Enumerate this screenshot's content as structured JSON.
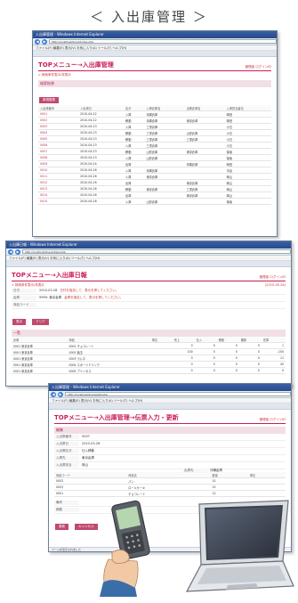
{
  "heading": "＜ 入出庫管理 ＞",
  "win1": {
    "titlebar": "入出庫管理 - Windows Internet Explorer",
    "address": "http://localhost/Inout/index.php",
    "menubar": "ファイル(F)  編集(E)  表示(V)  お気に入り(A)  ツール(T)  ヘルプ(H)",
    "page_title": "TOPメニュー→入出庫管理",
    "page_right": "管理者 ログインID",
    "link": "> 検索条件表示/非表示",
    "section": "検索結果",
    "new_btn": "新規登録",
    "headers": [
      "入出庫番号",
      "入出庫日",
      "区分",
      "入庫倉庫名",
      "出庫倉庫名",
      "入庫担当者名"
    ],
    "rows": [
      [
        "0001",
        "2010-04-22",
        "入庫",
        "沖縄倉庫",
        "",
        "岡田"
      ],
      [
        "0002",
        "2010-04-22",
        "移動",
        "沖縄倉庫",
        "東京倉庫",
        "岡田"
      ],
      [
        "0003",
        "2010-04-23",
        "入庫",
        "三重倉庫",
        "",
        "小島"
      ],
      [
        "0004",
        "2010-04-23",
        "移動",
        "三重倉庫",
        "山形倉庫",
        "小島"
      ],
      [
        "0005",
        "2010-04-23",
        "移動",
        "三重倉庫",
        "三重倉庫",
        "小島"
      ],
      [
        "0006",
        "2010-04-23",
        "入庫",
        "三重倉庫",
        "",
        "小島"
      ],
      [
        "0007",
        "2010-04-23",
        "移動",
        "山形倉庫",
        "東京倉庫",
        "保坂"
      ],
      [
        "0008",
        "2010-04-23",
        "入庫",
        "山形倉庫",
        "",
        "保坂"
      ],
      [
        "0009",
        "2010-04-24",
        "出庫",
        "",
        "沖縄倉庫",
        "岡田"
      ],
      [
        "0010",
        "2010-04-26",
        "入庫",
        "沖縄倉庫",
        "",
        "中谷"
      ],
      [
        "0011",
        "2010-04-26",
        "入庫",
        "東京倉庫",
        "",
        "岡山"
      ],
      [
        "0012",
        "2010-04-26",
        "出庫",
        "",
        "東京倉庫",
        "岡山"
      ],
      [
        "0013",
        "2010-04-26",
        "移動",
        "東京倉庫",
        "三重倉庫",
        "岡山"
      ],
      [
        "0014",
        "2010-04-26",
        "出庫",
        "",
        "東京倉庫",
        "岡山"
      ],
      [
        "0015",
        "2010-04-26",
        "入庫",
        "山形倉庫",
        "",
        "保坂"
      ]
    ]
  },
  "win2": {
    "titlebar": "入出庫日報 - Windows Internet Explorer",
    "address": "http://localhost/Inout/daily.php",
    "menubar": "ファイル(F)  編集(E)  表示(V)  お気に入り(A)  ツール(T)  ヘルプ(H)",
    "page_title": "TOPメニュー→入出庫日報",
    "page_right": "管理者 ログインID",
    "link": "> 検索条件表示/非表示",
    "date_right": "(2010-05-26)",
    "fields": [
      {
        "label": "日付",
        "value": "2010-03-28",
        "note": "日付を指定して、表示を押してください。"
      },
      {
        "label": "倉庫",
        "value": "9999: 東京倉庫",
        "note": "倉庫を指定して、表示を押してください。"
      },
      {
        "label": "商品コード",
        "value": "",
        "note": ""
      }
    ],
    "btn_show": "表示",
    "btn_clear": "クリア",
    "list_title": "一覧",
    "headers": [
      "倉庫",
      "商品",
      "単位",
      "売上",
      "仕入",
      "移動",
      "棚卸",
      "在庫"
    ],
    "rows": [
      [
        "0001 東京倉庫",
        "0001 チョコレート",
        "",
        "0",
        "0",
        "0",
        "0",
        "1"
      ],
      [
        "0001 東京倉庫",
        "0002 飴玉",
        "",
        "100",
        "0",
        "0",
        "0",
        "-100"
      ],
      [
        "0001 東京倉庫",
        "0003 ラムネ",
        "",
        "0",
        "0",
        "0",
        "0",
        "11"
      ],
      [
        "0001 東京倉庫",
        "0004 スポーツドリンク",
        "",
        "0",
        "0",
        "0",
        "0",
        "45"
      ],
      [
        "0001 東京倉庫",
        "0005 プリンセス",
        "",
        "0",
        "0",
        "0",
        "0",
        "0"
      ]
    ]
  },
  "win3": {
    "titlebar": "入出庫管理 - Windows Internet Explorer",
    "address": "http://localhost/Inout/edit.php",
    "menubar": "ファイル(F)  編集(E)  表示(V)  お気に入り(A)  ツール(T)  ヘルプ(H)",
    "page_title": "TOPメニュー→入出庫管理→伝票入力・更新",
    "page_right": "管理者 ログインID",
    "section": "編集",
    "fields": [
      {
        "label": "入出庫番号",
        "value": "0007"
      },
      {
        "label": "入出庫日",
        "value": "2010-03-28"
      },
      {
        "label": "入出庫区分",
        "value": "仕入移動"
      },
      {
        "label": "入庫先",
        "value": "東京倉庫"
      },
      {
        "label": "入出庫担当",
        "value": "岡山"
      }
    ],
    "out_label": "出庫先",
    "out_value": "沖縄倉庫",
    "item_headers": [
      "商品コード",
      "商品名",
      "数量",
      "単位"
    ],
    "items": [
      [
        "0002",
        "パン",
        "10",
        ""
      ],
      [
        "0003",
        "ロールケーキ",
        "15",
        ""
      ],
      [
        "0001",
        "チョコレート",
        "12",
        ""
      ]
    ],
    "notes": [
      {
        "label": "備考"
      },
      {
        "label": "摘要"
      }
    ],
    "btn_save": "更新",
    "btn_cancel": "キャンセル",
    "status": "ページが表示されました"
  }
}
